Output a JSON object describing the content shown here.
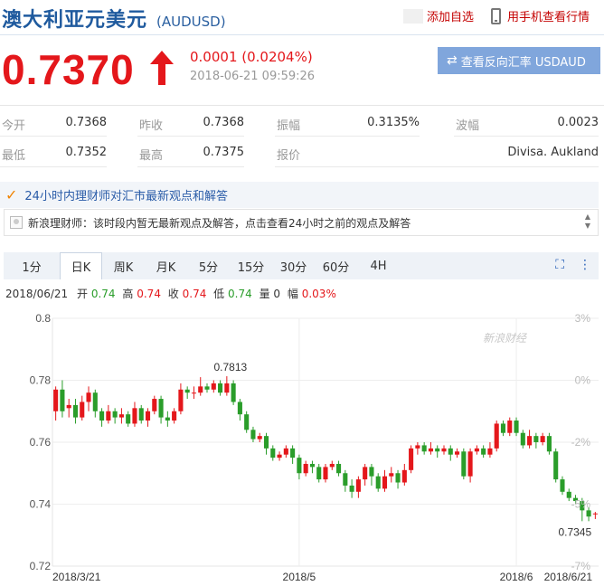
{
  "header": {
    "name": "澳大利亚元美元",
    "code": "(AUDUSD)",
    "add_fav_label": "添加自选",
    "mobile_label": "用手机查看行情"
  },
  "quote": {
    "price": "0.7370",
    "direction": "up",
    "change": "0.0001 (0.0204%)",
    "timestamp": "2018-06-21 09:59:26",
    "reverse_button_label": "查看反向汇率 USDAUD"
  },
  "stats": {
    "open_label": "今开",
    "open": "0.7368",
    "prev_close_label": "昨收",
    "prev_close": "0.7368",
    "amplitude_label": "振幅",
    "amplitude": "0.3135%",
    "range_label": "波幅",
    "range": "0.0023",
    "low_label": "最低",
    "low": "0.7352",
    "high_label": "最高",
    "high": "0.7375",
    "quote_by_label": "报价",
    "quote_by": "Divisa. Aukland"
  },
  "advisor": {
    "title": "24小时内理财师对汇市最新观点和解答",
    "notice": "新浪理财师：该时段内暂无最新观点及解答，点击查看24小时之前的观点及解答"
  },
  "tabs": [
    "1分",
    "日K",
    "周K",
    "月K",
    "5分",
    "15分",
    "30分",
    "60分",
    "4H"
  ],
  "active_tab": "日K",
  "ohlc": {
    "date": "2018/06/21",
    "open_label": "开",
    "open": "0.74",
    "high_label": "高",
    "high": "0.74",
    "close_label": "收",
    "close": "0.74",
    "low_label": "低",
    "low": "0.74",
    "volume_label": "量",
    "volume": "0",
    "change_label": "幅",
    "change": "0.03%"
  },
  "colors": {
    "up": "#e4171b",
    "down": "#2a9d2a",
    "brand_blue": "#1f5a9e",
    "button_blue": "#80a6dc"
  },
  "chart_data": {
    "type": "candlestick",
    "watermark": "新浪财经",
    "y_left_ticks": [
      "0.8",
      "0.78",
      "0.76",
      "0.74",
      "0.72"
    ],
    "y_right_ticks": [
      "3%",
      "0%",
      "-2%",
      "-5%",
      "-7%"
    ],
    "ylim": [
      0.72,
      0.8
    ],
    "x_ticks": [
      "2018/3/21",
      "2018/5",
      "2018/6",
      "2018/6/21"
    ],
    "annotations": {
      "max": "0.7813",
      "min": "0.7345"
    },
    "candles": [
      [
        0.77,
        0.777,
        0.778,
        0.767
      ],
      [
        0.777,
        0.77,
        0.78,
        0.768
      ],
      [
        0.771,
        0.772,
        0.774,
        0.768
      ],
      [
        0.772,
        0.768,
        0.774,
        0.766
      ],
      [
        0.768,
        0.773,
        0.775,
        0.767
      ],
      [
        0.773,
        0.776,
        0.778,
        0.77
      ],
      [
        0.776,
        0.77,
        0.777,
        0.768
      ],
      [
        0.77,
        0.767,
        0.771,
        0.765
      ],
      [
        0.767,
        0.77,
        0.772,
        0.766
      ],
      [
        0.77,
        0.768,
        0.771,
        0.766
      ],
      [
        0.768,
        0.769,
        0.771,
        0.766
      ],
      [
        0.769,
        0.766,
        0.77,
        0.765
      ],
      [
        0.766,
        0.771,
        0.773,
        0.765
      ],
      [
        0.771,
        0.767,
        0.772,
        0.766
      ],
      [
        0.767,
        0.77,
        0.771,
        0.765
      ],
      [
        0.77,
        0.774,
        0.775,
        0.769
      ],
      [
        0.774,
        0.768,
        0.775,
        0.766
      ],
      [
        0.768,
        0.767,
        0.77,
        0.765
      ],
      [
        0.767,
        0.77,
        0.771,
        0.766
      ],
      [
        0.77,
        0.777,
        0.779,
        0.769
      ],
      [
        0.777,
        0.776,
        0.778,
        0.774
      ],
      [
        0.776,
        0.776,
        0.778,
        0.774
      ],
      [
        0.776,
        0.778,
        0.781,
        0.775
      ],
      [
        0.778,
        0.777,
        0.779,
        0.776
      ],
      [
        0.777,
        0.779,
        0.78,
        0.776
      ],
      [
        0.779,
        0.776,
        0.78,
        0.775
      ],
      [
        0.776,
        0.779,
        0.7813,
        0.775
      ],
      [
        0.779,
        0.773,
        0.78,
        0.772
      ],
      [
        0.773,
        0.769,
        0.774,
        0.767
      ],
      [
        0.769,
        0.764,
        0.77,
        0.763
      ],
      [
        0.764,
        0.761,
        0.765,
        0.76
      ],
      [
        0.761,
        0.762,
        0.763,
        0.76
      ],
      [
        0.762,
        0.758,
        0.763,
        0.756
      ],
      [
        0.758,
        0.755,
        0.759,
        0.754
      ],
      [
        0.755,
        0.756,
        0.757,
        0.754
      ],
      [
        0.756,
        0.758,
        0.759,
        0.755
      ],
      [
        0.758,
        0.755,
        0.759,
        0.753
      ],
      [
        0.755,
        0.75,
        0.756,
        0.748
      ],
      [
        0.75,
        0.753,
        0.754,
        0.749
      ],
      [
        0.753,
        0.752,
        0.754,
        0.75
      ],
      [
        0.752,
        0.748,
        0.753,
        0.747
      ],
      [
        0.748,
        0.752,
        0.753,
        0.747
      ],
      [
        0.752,
        0.753,
        0.754,
        0.751
      ],
      [
        0.753,
        0.75,
        0.754,
        0.749
      ],
      [
        0.75,
        0.746,
        0.751,
        0.744
      ],
      [
        0.746,
        0.744,
        0.748,
        0.742
      ],
      [
        0.744,
        0.748,
        0.749,
        0.742
      ],
      [
        0.748,
        0.752,
        0.753,
        0.746
      ],
      [
        0.752,
        0.749,
        0.753,
        0.746
      ],
      [
        0.749,
        0.745,
        0.75,
        0.744
      ],
      [
        0.745,
        0.749,
        0.751,
        0.744
      ],
      [
        0.749,
        0.75,
        0.752,
        0.747
      ],
      [
        0.75,
        0.747,
        0.751,
        0.745
      ],
      [
        0.747,
        0.751,
        0.753,
        0.746
      ],
      [
        0.751,
        0.758,
        0.759,
        0.75
      ],
      [
        0.758,
        0.759,
        0.76,
        0.756
      ],
      [
        0.759,
        0.757,
        0.76,
        0.756
      ],
      [
        0.757,
        0.758,
        0.76,
        0.756
      ],
      [
        0.758,
        0.757,
        0.759,
        0.755
      ],
      [
        0.757,
        0.758,
        0.759,
        0.756
      ],
      [
        0.758,
        0.756,
        0.759,
        0.754
      ],
      [
        0.756,
        0.757,
        0.758,
        0.755
      ],
      [
        0.757,
        0.749,
        0.758,
        0.748
      ],
      [
        0.749,
        0.757,
        0.758,
        0.747
      ],
      [
        0.757,
        0.758,
        0.759,
        0.756
      ],
      [
        0.758,
        0.756,
        0.759,
        0.755
      ],
      [
        0.756,
        0.758,
        0.76,
        0.755
      ],
      [
        0.758,
        0.766,
        0.767,
        0.757
      ],
      [
        0.766,
        0.763,
        0.767,
        0.762
      ],
      [
        0.763,
        0.767,
        0.768,
        0.762
      ],
      [
        0.767,
        0.763,
        0.768,
        0.762
      ],
      [
        0.763,
        0.759,
        0.764,
        0.758
      ],
      [
        0.759,
        0.762,
        0.764,
        0.758
      ],
      [
        0.762,
        0.76,
        0.763,
        0.758
      ],
      [
        0.76,
        0.762,
        0.763,
        0.759
      ],
      [
        0.762,
        0.757,
        0.763,
        0.756
      ],
      [
        0.757,
        0.748,
        0.758,
        0.747
      ],
      [
        0.748,
        0.744,
        0.749,
        0.743
      ],
      [
        0.744,
        0.742,
        0.745,
        0.741
      ],
      [
        0.742,
        0.741,
        0.743,
        0.74
      ],
      [
        0.741,
        0.738,
        0.742,
        0.7345
      ],
      [
        0.738,
        0.736,
        0.739,
        0.7345
      ],
      [
        0.7368,
        0.737,
        0.7375,
        0.7352
      ]
    ]
  }
}
